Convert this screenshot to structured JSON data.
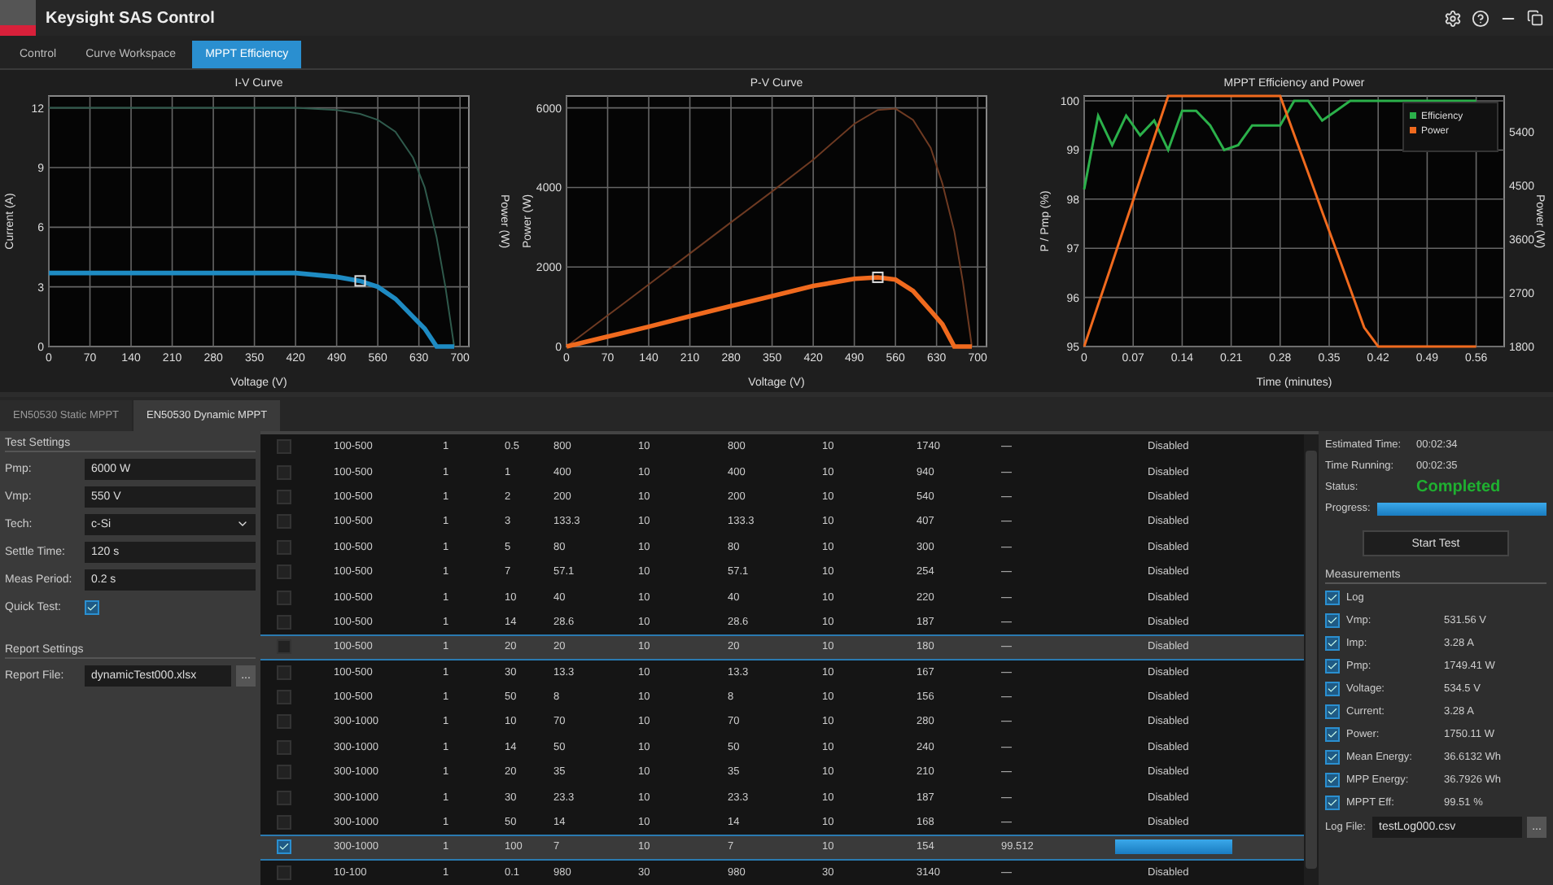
{
  "window": {
    "title": "Keysight SAS Control",
    "controls": [
      {
        "kind": "settings"
      },
      {
        "kind": "help"
      },
      {
        "kind": "minimize"
      },
      {
        "kind": "restore"
      }
    ]
  },
  "tabs": [
    {
      "label": "Control",
      "selected": false
    },
    {
      "label": "Curve Workspace",
      "selected": false
    },
    {
      "label": "MPPT Efficiency",
      "selected": true
    }
  ],
  "charts": [
    {
      "chart_data": {
        "type": "line",
        "title": "I-V Curve",
        "xlabel": "Voltage (V)",
        "ylabel": "Current (A)",
        "y2label": "Power (W)",
        "x": [
          0,
          70,
          140,
          210,
          280,
          350,
          420,
          490,
          530,
          560,
          590,
          620,
          640,
          660,
          675,
          690
        ],
        "xlim": [
          0,
          715
        ],
        "ylim": [
          0,
          12.6
        ],
        "xticks": [
          0,
          70,
          140,
          210,
          280,
          350,
          420,
          490,
          560,
          630,
          700
        ],
        "yticks": [
          0,
          3,
          6,
          9,
          12
        ],
        "series": [
          {
            "color": "#2f5a4c",
            "values": [
              12,
              12,
              12,
              12,
              12,
              12,
              12,
              11.9,
              11.7,
              11.4,
              10.8,
              9.5,
              8,
              5.5,
              3,
              0
            ]
          },
          {
            "color": "#1e8bc3",
            "values": [
              3.7,
              3.7,
              3.7,
              3.7,
              3.7,
              3.7,
              3.7,
              3.5,
              3.3,
              3.0,
              2.4,
              1.5,
              0.9,
              0,
              0,
              0
            ]
          }
        ],
        "grid": true
      }
    },
    {
      "chart_data": {
        "type": "line",
        "title": "P-V Curve",
        "xlabel": "Voltage (V)",
        "ylabel": "Power (W)",
        "x": [
          0,
          70,
          140,
          210,
          280,
          350,
          420,
          490,
          530,
          560,
          590,
          620,
          640,
          660,
          675,
          690
        ],
        "xlim": [
          0,
          715
        ],
        "ylim": [
          0,
          6300
        ],
        "xticks": [
          0,
          70,
          140,
          210,
          280,
          350,
          420,
          490,
          560,
          630,
          700
        ],
        "yticks": [
          0,
          2000,
          4000,
          6000
        ],
        "series": [
          {
            "color": "#6e3a22",
            "values": [
              0,
              780,
              1560,
              2340,
              3120,
              3900,
              4700,
              5600,
              5950,
              5980,
              5700,
              5000,
              4100,
              2900,
              1600,
              0
            ]
          },
          {
            "color": "#f06a1e",
            "values": [
              0,
              250,
              500,
              760,
              1020,
              1270,
              1520,
              1700,
              1740,
              1680,
              1400,
              900,
              560,
              0,
              0,
              0
            ]
          }
        ],
        "grid": true
      }
    },
    {
      "chart_data": {
        "type": "line",
        "title": "MPPT Efficiency and Power",
        "xlabel": "Time (minutes)",
        "ylabel": "P / Pmp (%)",
        "y2label": "Power (W)",
        "x": [
          0,
          0.02,
          0.04,
          0.06,
          0.08,
          0.1,
          0.12,
          0.14,
          0.16,
          0.18,
          0.2,
          0.22,
          0.24,
          0.26,
          0.28,
          0.3,
          0.32,
          0.34,
          0.36,
          0.38,
          0.4,
          0.42,
          0.44,
          0.46,
          0.48,
          0.5,
          0.52,
          0.54,
          0.56
        ],
        "xlim": [
          0,
          0.6
        ],
        "ylim": [
          95,
          100.1
        ],
        "y2lim": [
          1800,
          6000
        ],
        "xticks": [
          0,
          0.07,
          0.14,
          0.21,
          0.28,
          0.35,
          0.42,
          0.49,
          0.56
        ],
        "yticks": [
          95,
          96,
          97,
          98,
          99,
          100
        ],
        "grid": true,
        "legend": true,
        "y2ticks": [
          1800,
          2700,
          3600,
          4500,
          5400
        ],
        "series": [
          {
            "name": "Efficiency",
            "color": "#2bb04a",
            "values": [
              98.2,
              99.7,
              99.1,
              99.7,
              99.3,
              99.6,
              99.0,
              99.8,
              99.8,
              99.5,
              99.0,
              99.1,
              99.5,
              99.5,
              99.5,
              100,
              100,
              99.6,
              99.8,
              100,
              100,
              100,
              100,
              100,
              100,
              100,
              100,
              100,
              100
            ]
          },
          {
            "name": "Power",
            "axis": "y2",
            "color": "#f06a1e",
            "values": [
              1800,
              2500,
              3200,
              3900,
              4600,
              5300,
              6000,
              6000,
              6000,
              6000,
              6000,
              6000,
              6000,
              6000,
              6000,
              5350,
              4710,
              4060,
              3420,
              2770,
              2120,
              1800,
              1800,
              1800,
              1800,
              1800,
              1800,
              1800,
              1800
            ]
          }
        ]
      }
    }
  ],
  "test_tabs": [
    {
      "label": "EN50530 Static MPPT",
      "selected": false
    },
    {
      "label": "EN50530 Dynamic MPPT",
      "selected": true
    }
  ],
  "test_settings": {
    "heading": "Test Settings",
    "fields": [
      {
        "kind": "input",
        "label": "Pmp:",
        "value": "6000 W"
      },
      {
        "kind": "input",
        "label": "Vmp:",
        "value": "550 V"
      },
      {
        "kind": "select",
        "label": "Tech:",
        "value": "c-Si"
      },
      {
        "kind": "input",
        "label": "Settle Time:",
        "value": "120 s"
      },
      {
        "kind": "input",
        "label": "Meas Period:",
        "value": "0.2 s"
      },
      {
        "kind": "checkbox",
        "label": "Quick Test:",
        "checked": true
      }
    ]
  },
  "report_settings": {
    "heading": "Report Settings",
    "label": "Report File:",
    "value": "dynamicTest000.xlsx",
    "browse": "..."
  },
  "table": {
    "rows": [
      {
        "checked": false,
        "selected": false,
        "cells": [
          "100-500",
          "1",
          "0.5",
          "800",
          "10",
          "800",
          "10",
          "1740",
          "—"
        ],
        "status": {
          "kind": "text",
          "text": "Disabled"
        }
      },
      {
        "checked": false,
        "selected": false,
        "cells": [
          "100-500",
          "1",
          "1",
          "400",
          "10",
          "400",
          "10",
          "940",
          "—"
        ],
        "status": {
          "kind": "text",
          "text": "Disabled"
        }
      },
      {
        "checked": false,
        "selected": false,
        "cells": [
          "100-500",
          "1",
          "2",
          "200",
          "10",
          "200",
          "10",
          "540",
          "—"
        ],
        "status": {
          "kind": "text",
          "text": "Disabled"
        }
      },
      {
        "checked": false,
        "selected": false,
        "cells": [
          "100-500",
          "1",
          "3",
          "133.3",
          "10",
          "133.3",
          "10",
          "407",
          "—"
        ],
        "status": {
          "kind": "text",
          "text": "Disabled"
        }
      },
      {
        "checked": false,
        "selected": false,
        "cells": [
          "100-500",
          "1",
          "5",
          "80",
          "10",
          "80",
          "10",
          "300",
          "—"
        ],
        "status": {
          "kind": "text",
          "text": "Disabled"
        }
      },
      {
        "checked": false,
        "selected": false,
        "cells": [
          "100-500",
          "1",
          "7",
          "57.1",
          "10",
          "57.1",
          "10",
          "254",
          "—"
        ],
        "status": {
          "kind": "text",
          "text": "Disabled"
        }
      },
      {
        "checked": false,
        "selected": false,
        "cells": [
          "100-500",
          "1",
          "10",
          "40",
          "10",
          "40",
          "10",
          "220",
          "—"
        ],
        "status": {
          "kind": "text",
          "text": "Disabled"
        }
      },
      {
        "checked": false,
        "selected": false,
        "cells": [
          "100-500",
          "1",
          "14",
          "28.6",
          "10",
          "28.6",
          "10",
          "187",
          "—"
        ],
        "status": {
          "kind": "text",
          "text": "Disabled"
        }
      },
      {
        "checked": false,
        "selected": true,
        "cells": [
          "100-500",
          "1",
          "20",
          "20",
          "10",
          "20",
          "10",
          "180",
          "—"
        ],
        "status": {
          "kind": "text",
          "text": "Disabled"
        }
      },
      {
        "checked": false,
        "selected": false,
        "cells": [
          "100-500",
          "1",
          "30",
          "13.3",
          "10",
          "13.3",
          "10",
          "167",
          "—"
        ],
        "status": {
          "kind": "text",
          "text": "Disabled"
        }
      },
      {
        "checked": false,
        "selected": false,
        "cells": [
          "100-500",
          "1",
          "50",
          "8",
          "10",
          "8",
          "10",
          "156",
          "—"
        ],
        "status": {
          "kind": "text",
          "text": "Disabled"
        }
      },
      {
        "checked": false,
        "selected": false,
        "cells": [
          "300-1000",
          "1",
          "10",
          "70",
          "10",
          "70",
          "10",
          "280",
          "—"
        ],
        "status": {
          "kind": "text",
          "text": "Disabled"
        }
      },
      {
        "checked": false,
        "selected": false,
        "cells": [
          "300-1000",
          "1",
          "14",
          "50",
          "10",
          "50",
          "10",
          "240",
          "—"
        ],
        "status": {
          "kind": "text",
          "text": "Disabled"
        }
      },
      {
        "checked": false,
        "selected": false,
        "cells": [
          "300-1000",
          "1",
          "20",
          "35",
          "10",
          "35",
          "10",
          "210",
          "—"
        ],
        "status": {
          "kind": "text",
          "text": "Disabled"
        }
      },
      {
        "checked": false,
        "selected": false,
        "cells": [
          "300-1000",
          "1",
          "30",
          "23.3",
          "10",
          "23.3",
          "10",
          "187",
          "—"
        ],
        "status": {
          "kind": "text",
          "text": "Disabled"
        }
      },
      {
        "checked": false,
        "selected": false,
        "cells": [
          "300-1000",
          "1",
          "50",
          "14",
          "10",
          "14",
          "10",
          "168",
          "—"
        ],
        "status": {
          "kind": "text",
          "text": "Disabled"
        }
      },
      {
        "checked": true,
        "selected": true,
        "cells": [
          "300-1000",
          "1",
          "100",
          "7",
          "10",
          "7",
          "10",
          "154",
          "99.512"
        ],
        "status": {
          "kind": "progress",
          "level": 1
        }
      },
      {
        "checked": false,
        "selected": false,
        "cells": [
          "10-100",
          "1",
          "0.1",
          "980",
          "30",
          "980",
          "30",
          "3140",
          "—"
        ],
        "status": {
          "kind": "text",
          "text": "Disabled"
        }
      }
    ]
  },
  "run_panel": {
    "info": [
      {
        "label": "Estimated Time:",
        "value": "00:02:34"
      },
      {
        "label": "Time Running:",
        "value": "00:02:35"
      }
    ],
    "status_label": "Status:",
    "status": "Completed",
    "progress_label": "Progress:",
    "progress": {
      "level": 1
    },
    "start_button": "Start Test"
  },
  "measurements": {
    "heading": "Measurements",
    "items": [
      {
        "label": "Log",
        "checked": true
      },
      {
        "label": "Vmp:",
        "value": "531.56 V",
        "checked": true
      },
      {
        "label": "Imp:",
        "value": "3.28 A",
        "checked": true
      },
      {
        "label": "Pmp:",
        "value": "1749.41 W",
        "checked": true
      },
      {
        "label": "Voltage:",
        "value": "534.5 V",
        "checked": true
      },
      {
        "label": "Current:",
        "value": "3.28 A",
        "checked": true
      },
      {
        "label": "Power:",
        "value": "1750.11 W",
        "checked": true
      },
      {
        "label": "Mean Energy:",
        "value": "36.6132 Wh",
        "checked": true
      },
      {
        "label": "MPP Energy:",
        "value": "36.7926 Wh",
        "checked": true
      },
      {
        "label": "MPPT Eff:",
        "value": "99.51 %",
        "checked": true
      }
    ],
    "log_label": "Log File:",
    "log_value": "testLog000.csv",
    "browse": "..."
  }
}
